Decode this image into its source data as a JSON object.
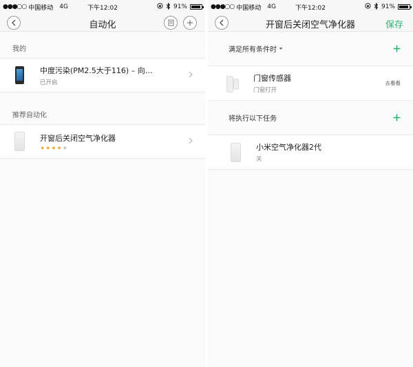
{
  "status_bar": {
    "left": {
      "signal": "●●●○○",
      "carrier": "中国移动",
      "network": "4G"
    },
    "right": {
      "time": "下午12:02",
      "battery": "91%",
      "battery_level": 0.91
    }
  },
  "left": {
    "nav": {
      "title": "自动化"
    },
    "section_mine": {
      "title": "我的",
      "items": [
        {
          "title": "中度污染(PM2.5大于116) – 向…",
          "status": "已开启"
        }
      ]
    },
    "section_recommended": {
      "title": "推荐自动化",
      "items": [
        {
          "title": "开窗后关闭空气净化器",
          "rating": 4,
          "rating_max": 5
        }
      ]
    }
  },
  "right": {
    "nav": {
      "title": "开窗后关闭空气净化器",
      "save": "保存"
    },
    "conditions": {
      "header": "满足所有条件时",
      "items": [
        {
          "title": "门窗传感器",
          "subtitle": "门窗打开",
          "action": "去看看"
        }
      ]
    },
    "tasks": {
      "header": "将执行以下任务",
      "items": [
        {
          "title": "小米空气净化器2代",
          "subtitle": "关"
        }
      ]
    }
  },
  "icons": {
    "back": "chevron-left-icon",
    "list": "list-icon",
    "add": "plus-icon",
    "chevron": "chevron-right-icon",
    "dropdown": "caret-down-icon",
    "bluetooth": "bluetooth-icon",
    "lock": "rotation-lock-icon"
  },
  "colors": {
    "accent": "#2bb673",
    "star": "#f0a030"
  }
}
